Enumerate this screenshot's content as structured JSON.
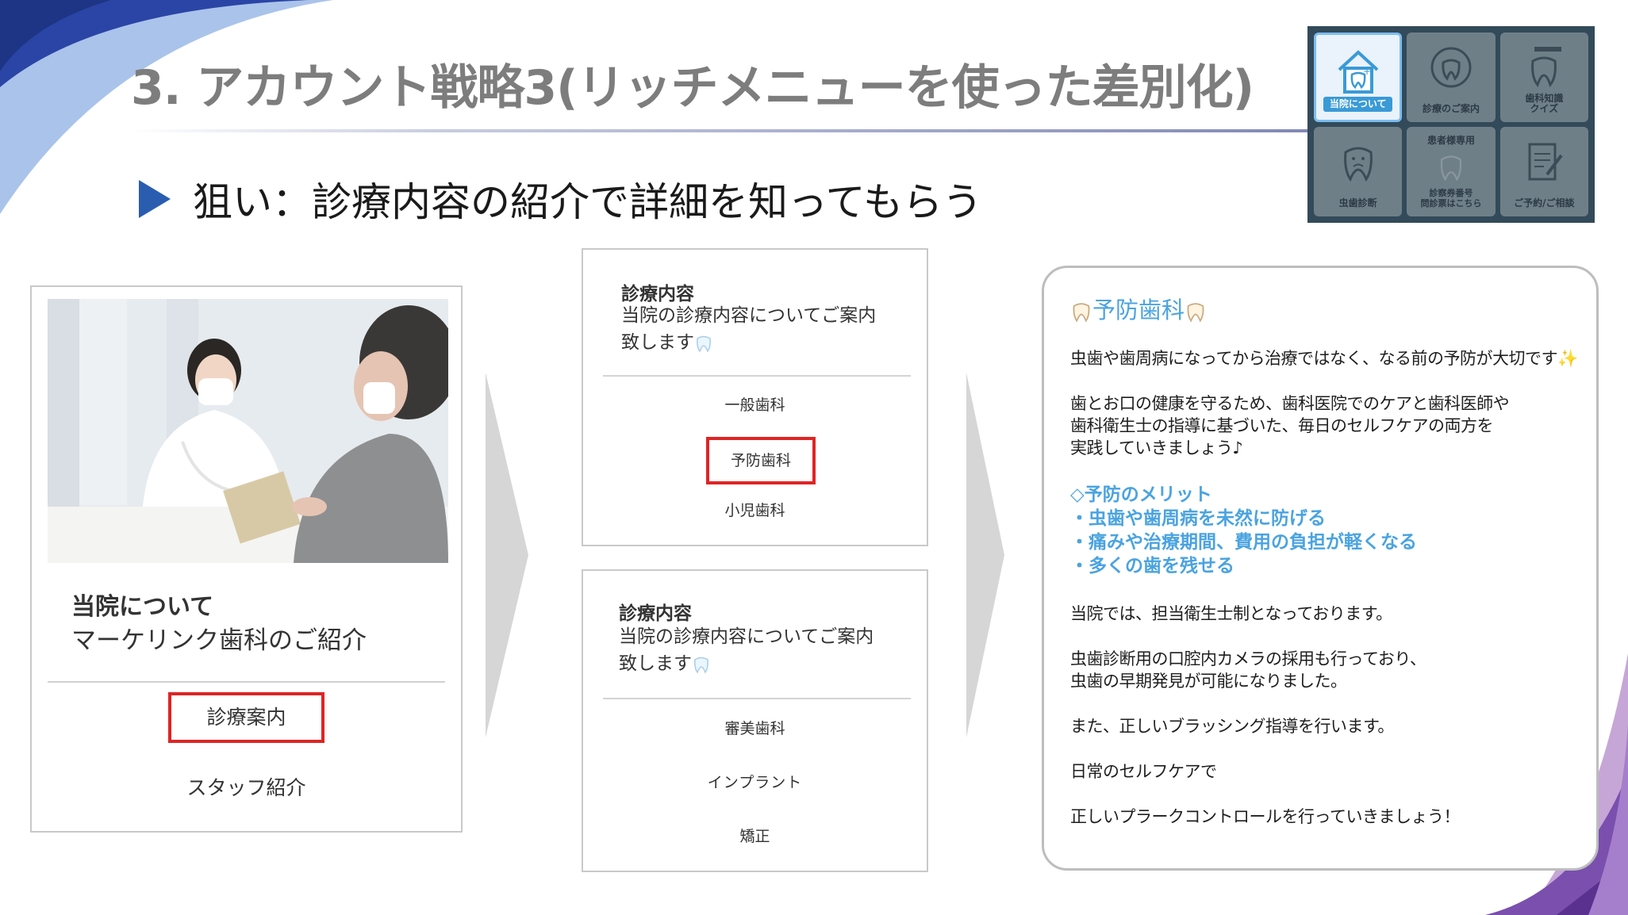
{
  "slide": {
    "title": "3. アカウント戦略3(リッチメニューを使った差別化)",
    "subtitle": "狙い：診療内容の紹介で詳細を知ってもらう"
  },
  "rich_menu": {
    "tiles": [
      {
        "label": "当院について",
        "active": true,
        "icon": "house-tooth-icon"
      },
      {
        "label": "診療のご案内",
        "active": false,
        "icon": "tooth-magnifier-icon"
      },
      {
        "label": "歯科知識\nクイズ",
        "active": false,
        "icon": "tooth-brush-icon"
      },
      {
        "label": "虫歯診断",
        "active": false,
        "icon": "sad-tooth-icon"
      },
      {
        "head": "患者様専用",
        "label": "診察券番号\n問診票はこちら",
        "active": false,
        "icon": "tooth-icon"
      },
      {
        "label": "ご予約/ご相談",
        "active": false,
        "icon": "clipboard-pen-icon"
      }
    ]
  },
  "card_about": {
    "title": "当院について",
    "subtitle": "マーケリンク歯科のご紹介",
    "buttons": [
      "診療案内",
      "スタッフ紹介"
    ]
  },
  "card_treatment_1": {
    "heading": "診療内容",
    "description": "当院の診療内容についてご案内致します",
    "items": [
      "一般歯科",
      "予防歯科",
      "小児歯科"
    ]
  },
  "card_treatment_2": {
    "heading": "診療内容",
    "description": "当院の診療内容についてご案内致します",
    "items": [
      "審美歯科",
      "インプラント",
      "矯正"
    ]
  },
  "message": {
    "title": "予防歯科",
    "lines": [
      "虫歯や歯周病になってから治療ではなく、なる前の予防が大切です",
      "歯とお口の健康を守るため、歯科医院でのケアと歯科医師や",
      "歯科衛生士の指導に基づいた、毎日のセルフケアの両方を",
      "実践していきましょう♪"
    ],
    "merits": [
      "◇予防のメリット",
      "・虫歯や歯周病を未然に防げる",
      "・痛みや治療期間、費用の負担が軽くなる",
      "・多くの歯を残せる"
    ],
    "tail": [
      "当院では、担当衛生士制となっております。",
      "虫歯診断用の口腔内カメラの採用も行っており、",
      "虫歯の早期発見が可能になりました。",
      "また、正しいブラッシング指導を行います。",
      "日常のセルフケアで",
      "正しいプラークコントロールを行っていきましょう！"
    ]
  },
  "colors": {
    "highlight": "#e02424",
    "accent_blue": "#4aa3e0",
    "title_gray": "#7d7d7d"
  }
}
